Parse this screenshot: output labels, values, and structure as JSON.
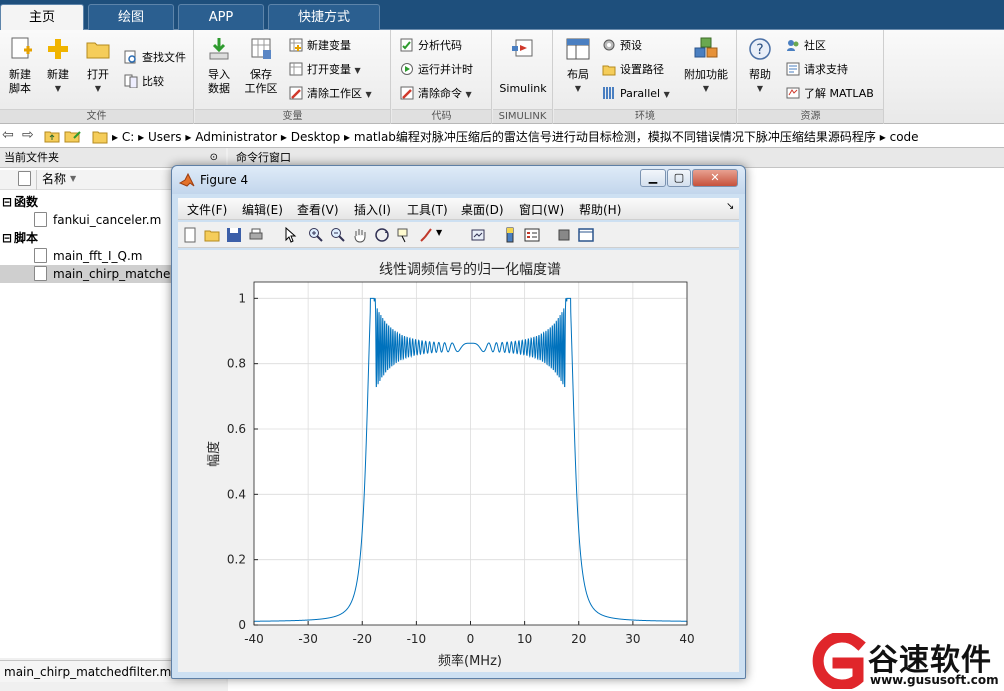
{
  "tabs": [
    {
      "label": "主页",
      "active": true
    },
    {
      "label": "绘图",
      "active": false
    },
    {
      "label": "APP",
      "active": false
    },
    {
      "label": "快捷方式",
      "active": false
    }
  ],
  "ribbon": {
    "file": {
      "group_label": "文件",
      "new_script": "新建\n脚本",
      "new": "新建",
      "open": "打开",
      "find_files": "查找文件",
      "compare": "比较"
    },
    "variable": {
      "group_label": "变量",
      "import_data": "导入\n数据",
      "save_workspace": "保存\n工作区",
      "new_variable": "新建变量",
      "open_variable": "打开变量",
      "clear_workspace": "清除工作区"
    },
    "code": {
      "group_label": "代码",
      "analyze_code": "分析代码",
      "run_and_time": "运行并计时",
      "clear_commands": "清除命令"
    },
    "simulink": {
      "group_label": "SIMULINK",
      "simulink": "Simulink"
    },
    "environment": {
      "group_label": "环境",
      "layout": "布局",
      "preferences": "预设",
      "set_path": "设置路径",
      "parallel": "Parallel",
      "addons": "附加功能"
    },
    "resources": {
      "group_label": "资源",
      "help": "帮助",
      "community": "社区",
      "request_support": "请求支持",
      "learn_matlab": "了解 MATLAB"
    }
  },
  "address": {
    "path_segments": [
      "C:",
      "Users",
      "Administrator",
      "Desktop",
      "matlab编程对脉冲压缩后的雷达信号进行动目标检测，模拟不同错误情况下脉冲压缩结果源码程序",
      "code"
    ]
  },
  "current_folder": {
    "title": "当前文件夹",
    "name_column": "名称",
    "groups": [
      {
        "label": "函数",
        "files": [
          "fankui_canceler.m"
        ]
      },
      {
        "label": "脚本",
        "files": [
          "main_fft_I_Q.m",
          "main_chirp_matched"
        ]
      }
    ],
    "status_file": "main_chirp_matchedfilter.m"
  },
  "command_window": {
    "title": "命令行窗口"
  },
  "figure": {
    "title": "Figure 4",
    "menus": [
      "文件(F)",
      "编辑(E)",
      "查看(V)",
      "插入(I)",
      "工具(T)",
      "桌面(D)",
      "窗口(W)",
      "帮助(H)"
    ]
  },
  "chart_data": {
    "type": "line",
    "title": "线性调频信号的归一化幅度谱",
    "xlabel": "频率(MHz)",
    "ylabel": "幅度",
    "xlim": [
      -40,
      40
    ],
    "ylim": [
      0,
      1.05
    ],
    "xticks": [
      -40,
      -30,
      -20,
      -10,
      0,
      10,
      20,
      30,
      40
    ],
    "yticks": [
      0,
      0.2,
      0.4,
      0.6,
      0.8,
      1
    ],
    "grid": true,
    "line_color": "#0072bd",
    "shape": {
      "band_edge_mhz": 18.5,
      "center_level": 0.85,
      "edge_peak": 1.0,
      "edge_dip": 0.75,
      "tail_at_40mhz": 0.01
    }
  },
  "watermark": {
    "brand": "谷速软件",
    "url": "www.gususoft.com"
  },
  "colors": {
    "tabbar": "#1e4f7c",
    "plot_line": "#0072bd",
    "watermark_red": "#e0262b"
  }
}
